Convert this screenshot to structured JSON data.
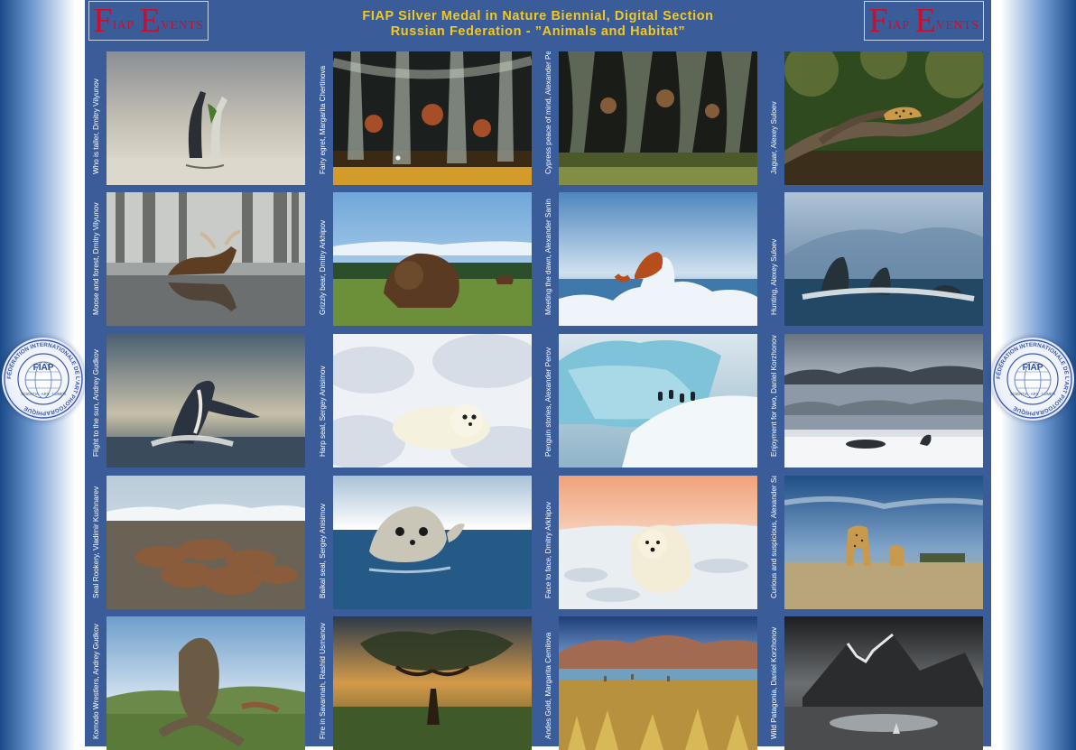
{
  "header": {
    "title_line1": "FIAP Silver Medal in Nature Biennial, Digital Section",
    "title_line2": "Russian Federation - ”Animals and Habitat”",
    "logo_big1": "F",
    "logo_small1": "IAP",
    "logo_big2": "E",
    "logo_small2": "VENTS"
  },
  "seal": {
    "ring_text": "FÉDÉRATION INTERNATIONALE DE L'ART PHOTOGRAPHIQUE",
    "center_text": "FIAP",
    "motto": "SCIENTIA · ARS · LUMEN"
  },
  "colors": {
    "panel": "#3a5d9a",
    "title": "#f3c81f",
    "logo_red": "#c8102e"
  },
  "photos": [
    {
      "caption": "Who is taller, Dmitry Vilyunov",
      "scene": "birds-pond"
    },
    {
      "caption": "Fairy egret, Margarita Chertinova",
      "scene": "cypress-night"
    },
    {
      "caption": "Cypress peace of mind, Alexander Perov",
      "scene": "cypress-green"
    },
    {
      "caption": "Jaguar, Alexey Suloev",
      "scene": "jaguar"
    },
    {
      "caption": "Moose and forest, Dmitry Vilyunov",
      "scene": "moose"
    },
    {
      "caption": "Grizzly bear, Dmitry Arkhipov",
      "scene": "bear"
    },
    {
      "caption": "Meeting the dawn, Alexander Sanin",
      "scene": "fox-ice"
    },
    {
      "caption": "Hunting, Alexey Suloev",
      "scene": "whales"
    },
    {
      "caption": "Flight to the sun, Andrey Gudkov",
      "scene": "breach"
    },
    {
      "caption": "Harp seal, Sergey Anisimov",
      "scene": "harp-seal"
    },
    {
      "caption": "Penguin stories, Alexander Perov",
      "scene": "penguins"
    },
    {
      "caption": "Enjoyment for two, Daniel Korzhonov",
      "scene": "seals-snow"
    },
    {
      "caption": "Seal Rookery, Vladimir Kushnarev",
      "scene": "walrus"
    },
    {
      "caption": "Baikal seal, Sergey Anisimov",
      "scene": "baikal-seal"
    },
    {
      "caption": "Face to face, Dmitry Arkhipov",
      "scene": "polar-bear"
    },
    {
      "caption": "Curious and suspicious, Alexander Sanin",
      "scene": "cheetah"
    },
    {
      "caption": "Komodo Wrestlers, Andrey Gudkov",
      "scene": "komodo"
    },
    {
      "caption": "Fire in Savannah, Rashid Usmanov",
      "scene": "savannah"
    },
    {
      "caption": "Andes Gold, Margarita Cemilova",
      "scene": "andes"
    },
    {
      "caption": "Wild Patagonia, Daniel Korzhonov",
      "scene": "patagonia"
    }
  ]
}
